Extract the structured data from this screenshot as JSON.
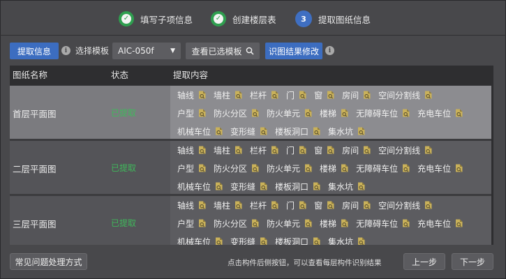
{
  "steps": [
    {
      "label": "填写子项信息",
      "state": "done"
    },
    {
      "label": "创建楼层表",
      "state": "done"
    },
    {
      "label": "提取图纸信息",
      "state": "active",
      "number": "3"
    }
  ],
  "toolbar": {
    "extract_button": "提取信息",
    "template_label": "选择模板",
    "template_value": "AIC-050f",
    "view_template_button": "查看已选模板",
    "modify_result_button": "识图结果修改",
    "info_glyph": "i"
  },
  "table": {
    "columns": [
      "图纸名称",
      "状态",
      "提取内容"
    ],
    "rows": [
      {
        "name": "首层平面图",
        "status": "已提取",
        "selected": true,
        "lines": [
          [
            "轴线",
            "墙柱",
            "栏杆",
            "门",
            "窗",
            "房间",
            "空间分割线"
          ],
          [
            "户型",
            "防火分区",
            "防火单元",
            "楼梯",
            "无障碍车位",
            "充电车位"
          ],
          [
            "机械车位",
            "变形缝",
            "楼板洞口",
            "集水坑"
          ]
        ]
      },
      {
        "name": "二层平面图",
        "status": "已提取",
        "selected": false,
        "lines": [
          [
            "轴线",
            "墙柱",
            "栏杆",
            "门",
            "窗",
            "房间",
            "空间分割线"
          ],
          [
            "户型",
            "防火分区",
            "防火单元",
            "楼梯",
            "无障碍车位",
            "充电车位"
          ],
          [
            "机械车位",
            "变形缝",
            "楼板洞口",
            "集水坑"
          ]
        ]
      },
      {
        "name": "三层平面图",
        "status": "已提取",
        "selected": false,
        "lines": [
          [
            "轴线",
            "墙柱",
            "栏杆",
            "门",
            "窗",
            "房间",
            "空间分割线"
          ],
          [
            "户型",
            "防火分区",
            "防火单元",
            "楼梯",
            "无障碍车位",
            "充电车位"
          ],
          [
            "机械车位",
            "变形缝",
            "楼板洞口",
            "集水坑"
          ]
        ]
      }
    ]
  },
  "footer": {
    "faq_button": "常见问题处理方式",
    "hint": "点击构件后侧按钮，可以查看每层构件识别结果",
    "prev_button": "上一步",
    "next_button": "下一步"
  },
  "colors": {
    "accent_blue": "#3c6dc0",
    "success_green": "#2f9e4f",
    "status_green": "#3fb95b",
    "icon_gold": "#c9b15a"
  }
}
